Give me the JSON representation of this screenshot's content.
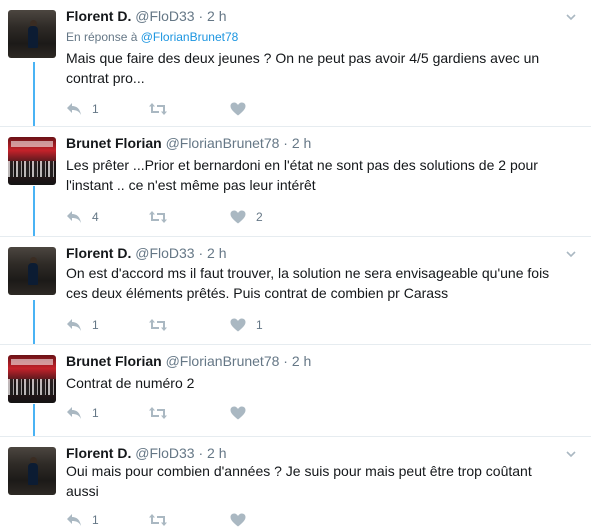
{
  "colors": {
    "accent": "#1b95e0",
    "thread_line": "#4ab3f4",
    "muted": "#657786",
    "text": "#14171a",
    "separator": "#e6ecf0"
  },
  "icons": {
    "reply": "reply-icon",
    "retweet": "retweet-icon",
    "like": "heart-icon",
    "more": "chevron-down-icon"
  },
  "tweets": [
    {
      "name": "Florent D.",
      "handle": "@FloD33",
      "dot": "·",
      "time": "2 h",
      "reply_prefix": "En réponse à",
      "reply_handle": "@FlorianBrunet78",
      "text": "Mais que faire des deux jeunes ? On ne peut pas avoir 4/5 gardiens avec un contrat pro...",
      "reply_count": "1",
      "retweet_count": "",
      "like_count": ""
    },
    {
      "name": "Brunet Florian",
      "handle": "@FlorianBrunet78",
      "dot": "·",
      "time": "2 h",
      "text": "Les prêter ...Prior et bernardoni en l'état ne sont pas des solutions de 2 pour l'instant .. ce n'est même pas leur intérêt",
      "reply_count": "4",
      "retweet_count": "",
      "like_count": "2"
    },
    {
      "name": "Florent D.",
      "handle": "@FloD33",
      "dot": "·",
      "time": "2 h",
      "text": "On est d'accord ms il faut trouver, la solution ne sera envisageable qu'une fois ces deux éléments prêtés. Puis contrat de combien pr Carass",
      "reply_count": "1",
      "retweet_count": "",
      "like_count": "1"
    },
    {
      "name": "Brunet Florian",
      "handle": "@FlorianBrunet78",
      "dot": "·",
      "time": "2 h",
      "text": "Contrat de numéro 2",
      "reply_count": "1",
      "retweet_count": "",
      "like_count": ""
    },
    {
      "name": "Florent D.",
      "handle": "@FloD33",
      "dot": "·",
      "time": "2 h",
      "text": "Oui mais pour combien d'années ? Je suis pour mais peut être trop coûtant aussi",
      "reply_count": "1",
      "retweet_count": "",
      "like_count": ""
    }
  ]
}
